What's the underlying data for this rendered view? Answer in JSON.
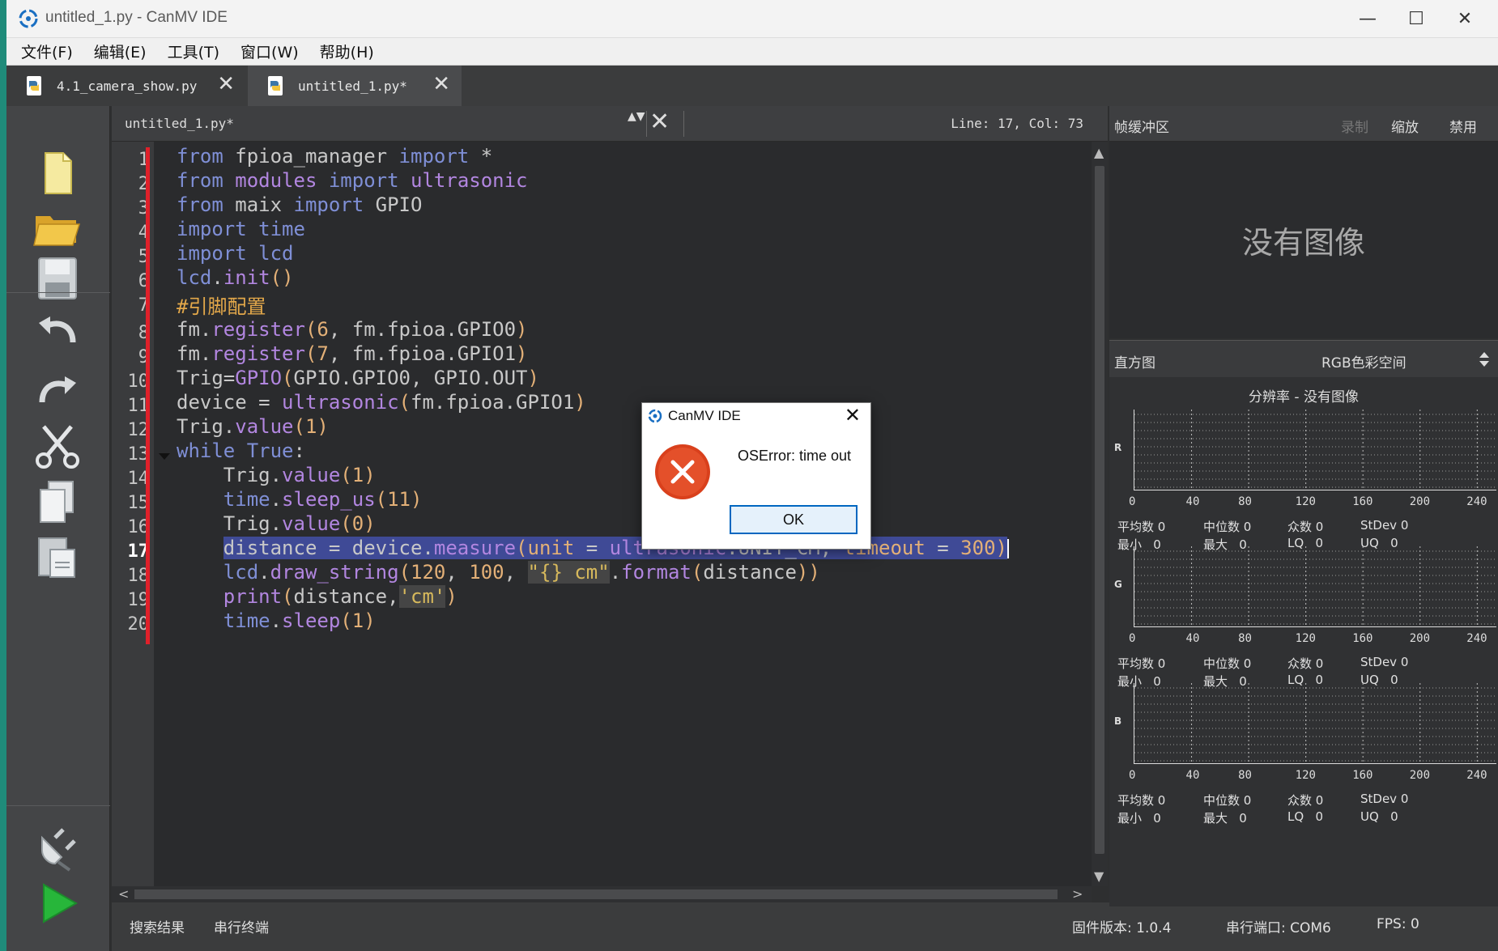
{
  "window": {
    "title": "untitled_1.py - CanMV IDE",
    "minimize": "—",
    "maximize": "☐",
    "close": "✕"
  },
  "menu": [
    "文件(F)",
    "编辑(E)",
    "工具(T)",
    "窗口(W)",
    "帮助(H)"
  ],
  "tabs": [
    {
      "label": "4.1_camera_show.py",
      "close": "✕",
      "active": false
    },
    {
      "label": "untitled_1.py*",
      "close": "✕",
      "active": true
    }
  ],
  "editor": {
    "filename": "untitled_1.py*",
    "updown": "▲▼",
    "close": "✕",
    "position": "Line: 17, Col: 73",
    "current_line": 17,
    "line_numbers": [
      "1",
      "2",
      "3",
      "4",
      "5",
      "6",
      "7",
      "8",
      "9",
      "10",
      "11",
      "12",
      "13",
      "14",
      "15",
      "16",
      "17",
      "18",
      "19",
      "20"
    ],
    "code": [
      "from fpioa_manager import *",
      "from modules import ultrasonic",
      "from maix import GPIO",
      "import time",
      "import lcd",
      "lcd.init()",
      "#引脚配置",
      "fm.register(6, fm.fpioa.GPIO0)",
      "fm.register(7, fm.fpioa.GPIO1)",
      "Trig=GPIO(GPIO.GPIO0, GPIO.OUT)",
      "device = ultrasonic(fm.fpioa.GPIO1)",
      "Trig.value(1)",
      "while True:",
      "    Trig.value(1)",
      "    time.sleep_us(11)",
      "    Trig.value(0)",
      "    distance = device.measure(unit = ultrasonic.UNIT_CM, timeout = 300)",
      "    lcd.draw_string(120, 100, \"{} cm\".format(distance))",
      "    print(distance,'cm')",
      "    time.sleep(1)"
    ]
  },
  "scroll": {
    "up": "▲",
    "down": "▼",
    "left": "<",
    "right": ">"
  },
  "statusbar": {
    "search_results": "搜索结果",
    "serial_terminal": "串行终端",
    "firmware": "固件版本: 1.0.4",
    "serial_port": "串行端口: COM6",
    "fps": "FPS: 0"
  },
  "framebuffer": {
    "label": "帧缓冲区",
    "record": "录制",
    "zoom": "缩放",
    "disable": "禁用",
    "no_image": "没有图像"
  },
  "histogram": {
    "label": "直方图",
    "colorspace": "RGB色彩空间",
    "resolution": "分辨率 - 没有图像",
    "x_ticks": [
      "0",
      "40",
      "80",
      "120",
      "160",
      "200",
      "240"
    ],
    "channels": [
      {
        "label": "R",
        "stats_row1": [
          "平均数 0",
          "中位数 0",
          "众数 0",
          "StDev 0"
        ],
        "stats_row2": [
          "最小   0",
          "最大   0",
          "LQ   0",
          "UQ   0"
        ]
      },
      {
        "label": "G",
        "stats_row1": [
          "平均数 0",
          "中位数 0",
          "众数 0",
          "StDev 0"
        ],
        "stats_row2": [
          "最小   0",
          "最大   0",
          "LQ   0",
          "UQ   0"
        ]
      },
      {
        "label": "B",
        "stats_row1": [
          "平均数 0",
          "中位数 0",
          "众数 0",
          "StDev 0"
        ],
        "stats_row2": [
          "最小   0",
          "最大   0",
          "LQ   0",
          "UQ   0"
        ]
      }
    ]
  },
  "dialog": {
    "title": "CanMV IDE",
    "close": "✕",
    "message": "OSError: time out",
    "ok_label": "OK"
  },
  "colors": {
    "editor_bg": "#2a2b2d",
    "selection": "#3f4a96",
    "keyword": "#7f8fd6",
    "function": "#b286e0",
    "error_red": "#e0202a",
    "accent_blue": "#0067c0"
  }
}
